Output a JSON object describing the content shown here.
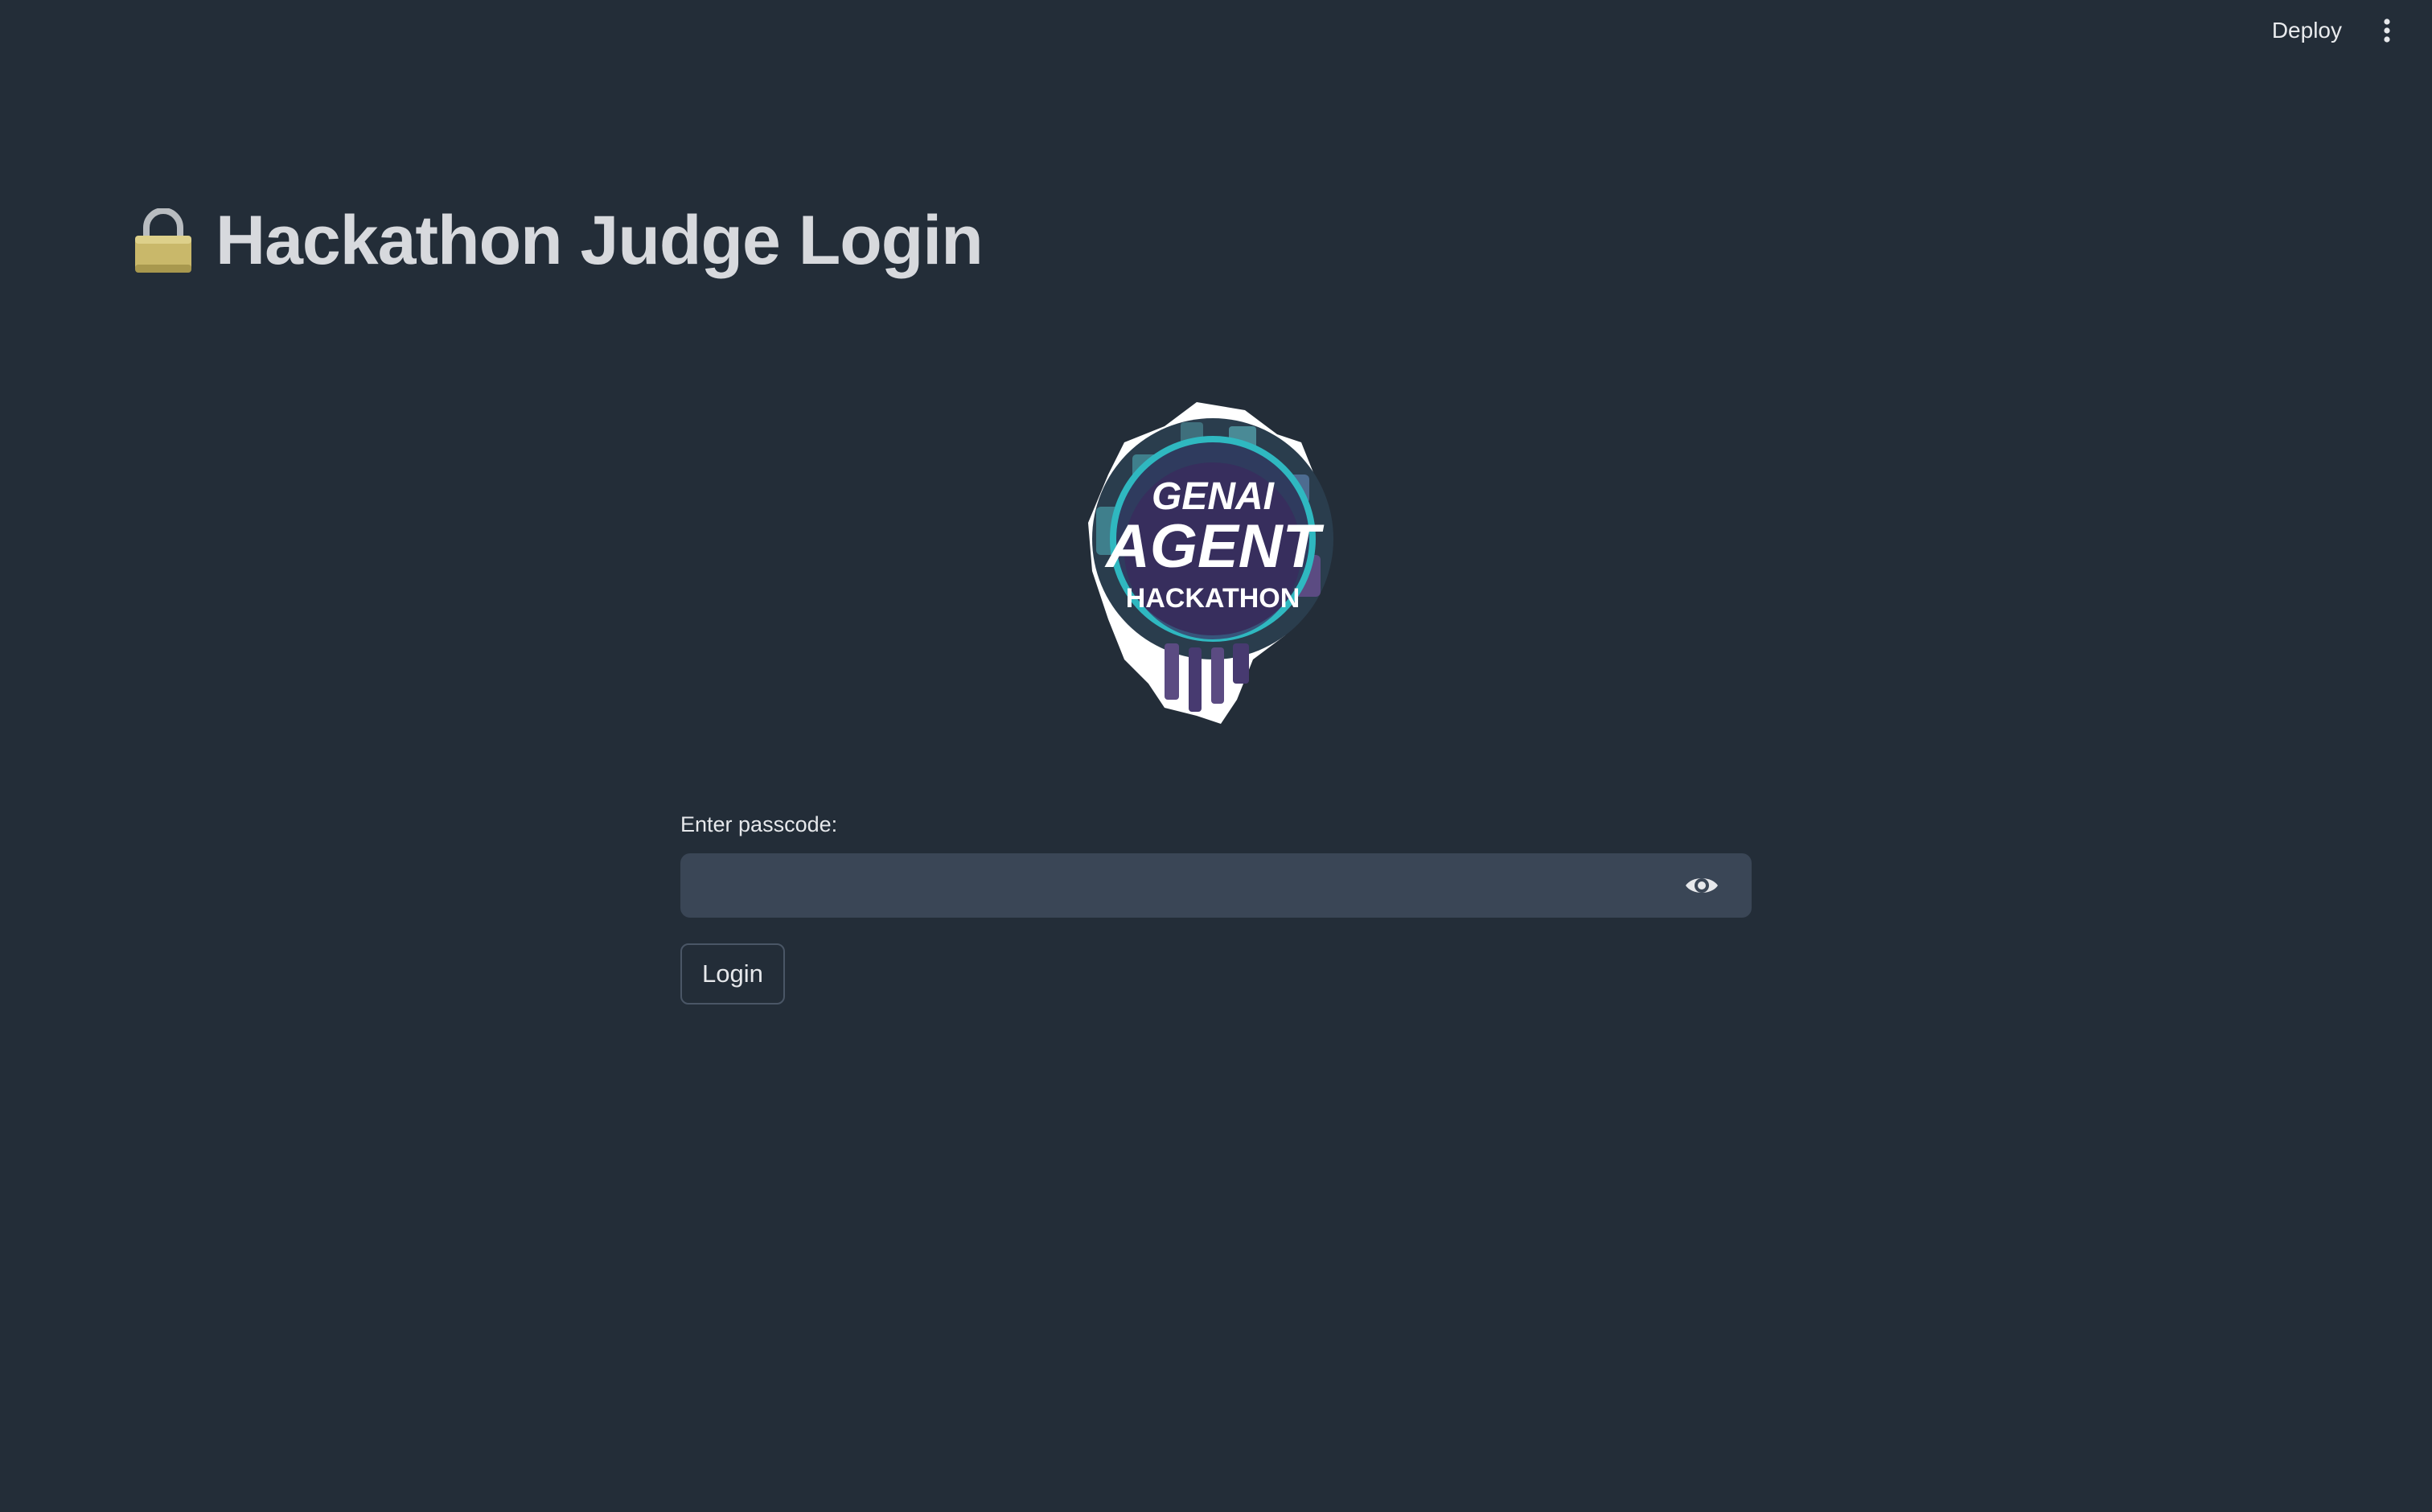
{
  "header": {
    "deploy_label": "Deploy",
    "menu_icon": "vertical-ellipsis-icon"
  },
  "page": {
    "title": "Hackathon Judge Login",
    "title_icon": "lock-icon"
  },
  "logo": {
    "line1": "GENAI",
    "line2": "AGENT",
    "line3": "HACKATHON"
  },
  "form": {
    "label": "Enter passcode:",
    "value": "",
    "eye_icon": "eye-icon",
    "login_label": "Login"
  },
  "colors": {
    "background": "#232d38",
    "input_bg": "#3a4656",
    "logo_teal": "#2fb8c0",
    "logo_purple": "#3b2a5c"
  }
}
